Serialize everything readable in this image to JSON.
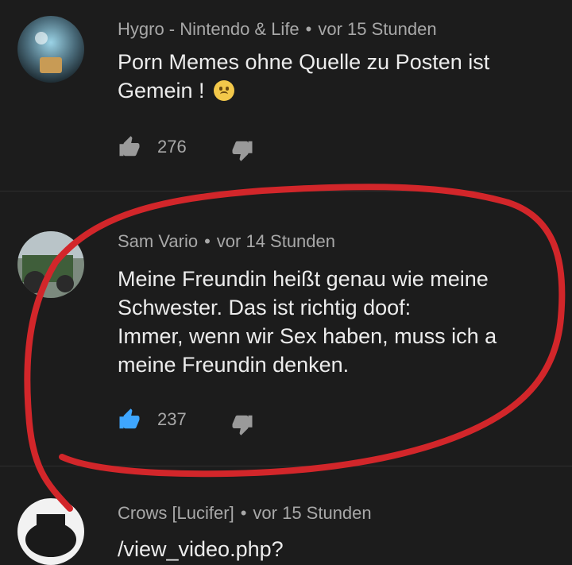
{
  "comments": [
    {
      "author": "Hygro - Nintendo & Life",
      "time": "vor 15 Stunden",
      "lines": [
        "Porn Memes ohne Quelle zu Posten ist",
        "Gemein !"
      ],
      "likes": "276",
      "emoji": "worried-face"
    },
    {
      "author": "Sam Vario",
      "time": "vor 14 Stunden",
      "lines": [
        "Meine Freundin heißt genau wie meine",
        "Schwester. Das ist richtig doof:",
        "Immer, wenn wir Sex haben, muss ich a",
        "meine Freundin denken."
      ],
      "likes": "237"
    },
    {
      "author": "Crows [Lucifer]",
      "time": "vor 15 Stunden",
      "lines": [
        "/view_video.php?"
      ]
    }
  ],
  "separator": "•",
  "colors": {
    "background": "#1c1c1c",
    "highlight": "#d2262a",
    "like_active": "#3ea6ff"
  }
}
